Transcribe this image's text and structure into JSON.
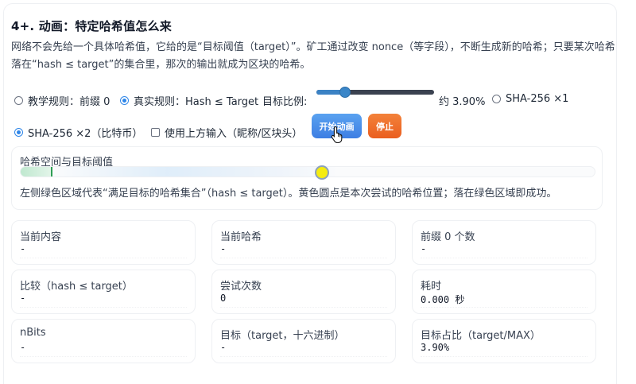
{
  "section": {
    "title": "4+. 动画：特定哈希值怎么来",
    "description": "网络不会先给一个具体哈希值，它给的是“目标阈值（target）”。矿工通过改变 nonce（等字段），不断生成新的哈希；只要某次哈希落在“hash ≤ target”的集合里，那次的输出就成为区块的哈希。"
  },
  "controls": {
    "rule_teaching": {
      "label": "教学规则：前缀 0",
      "selected": false
    },
    "rule_real": {
      "label": "真实规则：Hash ≤ Target",
      "selected": true
    },
    "ratio_label": "目标比例:",
    "ratio_value": "约 3.90%",
    "ratio_fraction": 0.22,
    "sha_x1": {
      "label": "SHA-256 ×1",
      "selected": false
    },
    "sha_x2": {
      "label": "SHA-256 ×2（比特币）",
      "selected": true
    },
    "use_input": {
      "label": "使用上方输入（昵称/区块头）",
      "checked": false
    },
    "start_button": "开始动画",
    "stop_button": "停止"
  },
  "hash_space": {
    "title": "哈希空间与目标阈值",
    "target_fraction": 0.039,
    "current_fraction": 0.525,
    "note": "左侧绿色区域代表“满足目标的哈希集合”（hash ≤ target）。黄色圆点是本次尝试的哈希位置；落在绿色区域即成功。",
    "colors": {
      "target_zone": "#bfe8cf",
      "current_dot": "#f5ec10"
    }
  },
  "stats": [
    {
      "label": "当前内容",
      "value": "-"
    },
    {
      "label": "当前哈希",
      "value": "-"
    },
    {
      "label": "前缀 0 个数",
      "value": "-"
    },
    {
      "label": "比较（hash ≤ target）",
      "value": "-"
    },
    {
      "label": "尝试次数",
      "value": "0"
    },
    {
      "label": "耗时",
      "value": "0.000 秒"
    },
    {
      "label": "nBits",
      "value": "-"
    },
    {
      "label": "目标（target，十六进制）",
      "value": "-"
    },
    {
      "label": "目标占比（target/MAX）",
      "value": "3.90%"
    }
  ],
  "colors": {
    "accent": "#2f86e8",
    "start_button": "#3d7ee3",
    "stop_button": "#ea5e1f"
  },
  "icons": {
    "cursor": "hand-pointer-icon"
  }
}
